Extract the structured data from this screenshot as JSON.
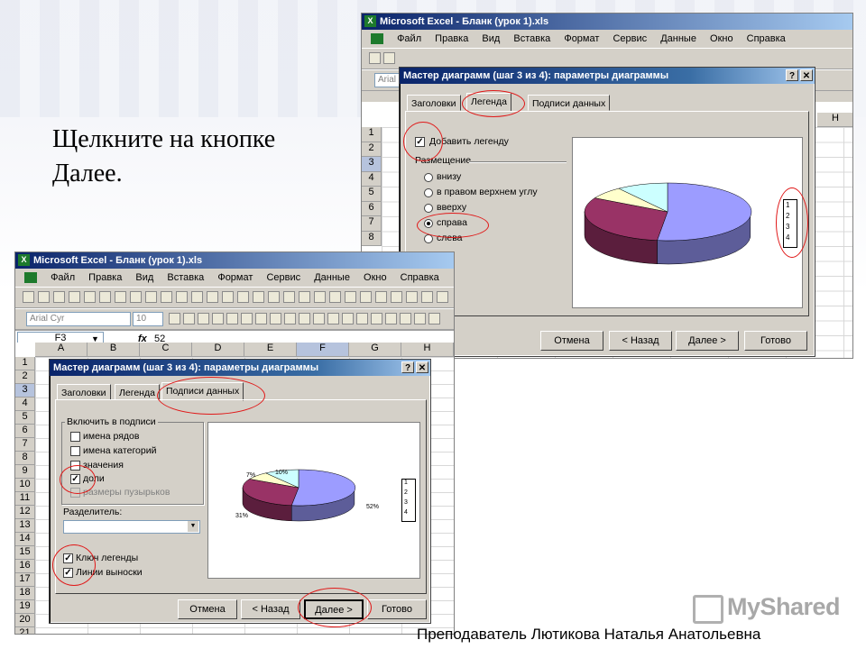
{
  "slide": {
    "instruction": "Щелкните на кнопке Далее.",
    "footer": "Преподаватель Лютикова Наталья Анатольевна",
    "logo": "MyShared"
  },
  "excel_window_back": {
    "title": "Microsoft Excel - Бланк (урок 1).xls",
    "menu": [
      "Файл",
      "Правка",
      "Вид",
      "Вставка",
      "Формат",
      "Сервис",
      "Данные",
      "Окно",
      "Справка"
    ],
    "font_box": "Arial",
    "column_H": "H",
    "rows": [
      "1",
      "2",
      "3",
      "4",
      "5",
      "6",
      "7",
      "8"
    ]
  },
  "dialog_back": {
    "title": "Мастер диаграмм (шаг 3 из 4): параметры диаграммы",
    "help_btn": "?",
    "close_btn": "✕",
    "tabs": [
      "Заголовки",
      "Легенда",
      "Подписи данных"
    ],
    "active_tab": "Легенда",
    "add_legend_label": "Добавить легенду",
    "add_legend_checked": true,
    "placement_label": "Размещение",
    "placement_options": [
      "внизу",
      "в правом верхнем углу",
      "вверху",
      "справа",
      "слева"
    ],
    "placement_selected": "справа",
    "legend_entries": [
      "1",
      "2",
      "3",
      "4"
    ],
    "buttons": {
      "cancel": "Отмена",
      "back": "< Назад",
      "next": "Далее >",
      "finish": "Готово"
    }
  },
  "excel_window_front": {
    "title": "Microsoft Excel - Бланк (урок 1).xls",
    "menu": [
      "Файл",
      "Правка",
      "Вид",
      "Вставка",
      "Формат",
      "Сервис",
      "Данные",
      "Окно",
      "Справка"
    ],
    "font_box": "Arial Cyr",
    "size_box": "10",
    "cell_ref": "F3",
    "fx": "fx",
    "formula_value": "52",
    "columns": [
      "A",
      "B",
      "C",
      "D",
      "E",
      "F",
      "G",
      "H"
    ],
    "rows": [
      "1",
      "2",
      "3",
      "4",
      "5",
      "6",
      "7",
      "8",
      "9",
      "10",
      "11",
      "12",
      "13",
      "14",
      "15",
      "16",
      "17",
      "18",
      "19",
      "20",
      "21"
    ]
  },
  "dialog_front": {
    "title": "Мастер диаграмм (шаг 3 из 4): параметры диаграммы",
    "help_btn": "?",
    "close_btn": "✕",
    "tabs": [
      "Заголовки",
      "Легенда",
      "Подписи данных"
    ],
    "active_tab": "Подписи данных",
    "include_group_label": "Включить в подписи",
    "include_options": [
      {
        "label": "имена рядов",
        "checked": false,
        "enabled": true
      },
      {
        "label": "имена категорий",
        "checked": false,
        "enabled": true
      },
      {
        "label": "значения",
        "checked": false,
        "enabled": true
      },
      {
        "label": "доли",
        "checked": true,
        "enabled": true
      },
      {
        "label": "размеры пузырьков",
        "checked": false,
        "enabled": false
      }
    ],
    "separator_label": "Разделитель:",
    "legend_key_label": "Ключ легенды",
    "leader_lines_label": "Линии выноски",
    "legend_key_checked": true,
    "leader_lines_checked": true,
    "slice_labels": [
      "7%",
      "10%",
      "31%",
      "52%"
    ],
    "legend_entries": [
      "1",
      "2",
      "3",
      "4"
    ],
    "buttons": {
      "cancel": "Отмена",
      "back": "< Назад",
      "next": "Далее >",
      "finish": "Готово"
    }
  },
  "chart_data": {
    "type": "pie",
    "categories": [
      "1",
      "2",
      "3",
      "4"
    ],
    "values": [
      52,
      31,
      7,
      10
    ],
    "slice_colors": [
      "#9c9cff",
      "#993366",
      "#ffffcc",
      "#ccffff"
    ]
  }
}
